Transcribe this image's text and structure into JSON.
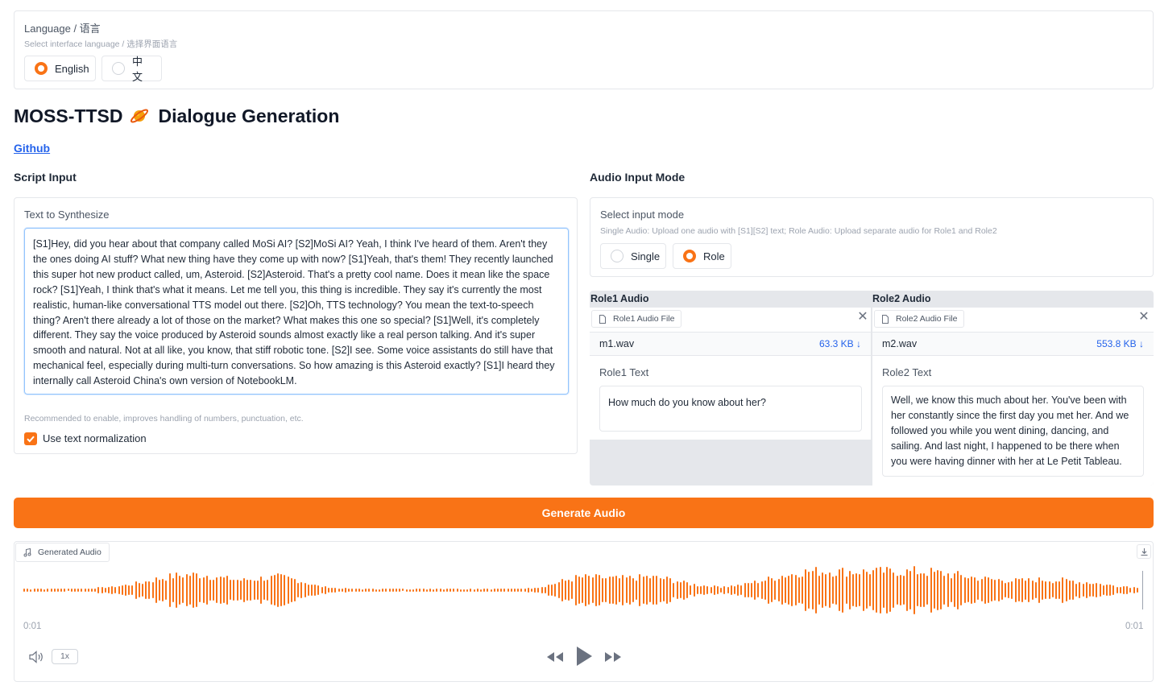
{
  "language": {
    "label": "Language / 语言",
    "info": "Select interface language / 选择界面语言",
    "options": [
      "English",
      "中文"
    ],
    "selected": "English"
  },
  "header": {
    "title": "MOSS-TTSD",
    "subtitle": "Dialogue Generation",
    "link": "Github"
  },
  "script": {
    "section_title": "Script Input",
    "label": "Text to Synthesize",
    "text": "[S1]Hey, did you hear about that company called MoSi AI? [S2]MoSi AI? Yeah, I think I've heard of them. Aren't they the ones doing AI stuff? What new thing have they come up with now? [S1]Yeah, that's them! They recently launched this super hot new product called, um, Asteroid. [S2]Asteroid. That's a pretty cool name. Does it mean like the space rock? [S1]Yeah, I think that's what it means. Let me tell you, this thing is incredible. They say it's currently the most realistic, human-like conversational TTS model out there. [S2]Oh, TTS technology? You mean the text-to-speech thing? Aren't there already a lot of those on the market? What makes this one so special? [S1]Well, it's completely different. They say the voice produced by Asteroid sounds almost exactly like a real person talking. And it's super smooth and natural. Not at all like, you know, that stiff robotic tone. [S2]I see. Some voice assistants do still have that mechanical feel, especially during multi-turn conversations. So how amazing is this Asteroid exactly? [S1]I heard they internally call Asteroid China's own version of NotebookLM.",
    "normalize_info": "Recommended to enable, improves handling of numbers, punctuation, etc.",
    "normalize_label": "Use text normalization",
    "normalize_checked": true
  },
  "audio_mode": {
    "section_title": "Audio Input Mode",
    "label": "Select input mode",
    "info": "Single Audio: Upload one audio with [S1][S2] text; Role Audio: Upload separate audio for Role1 and Role2",
    "options": [
      "Single",
      "Role"
    ],
    "selected": "Role"
  },
  "role1": {
    "title": "Role1 Audio",
    "file_chip": "Role1 Audio File",
    "file_name": "m1.wav",
    "file_size": "63.3 KB ↓",
    "text_label": "Role1 Text",
    "text": "How much do you know about her?"
  },
  "role2": {
    "title": "Role2 Audio",
    "file_chip": "Role2 Audio File",
    "file_name": "m2.wav",
    "file_size": "553.8 KB ↓",
    "text_label": "Role2 Text",
    "text": "Well, we know this much about her. You've been with her constantly since the first day you met her. And we followed you while you went dining, dancing, and sailing. And last night, I happened to be there when you were having dinner with her at Le Petit Tableau."
  },
  "generate_button": "Generate Audio",
  "player": {
    "label": "Generated Audio",
    "time_start": "0:01",
    "time_end": "0:01",
    "speed": "1x"
  },
  "colors": {
    "accent": "#f97316",
    "link": "#2563eb"
  }
}
